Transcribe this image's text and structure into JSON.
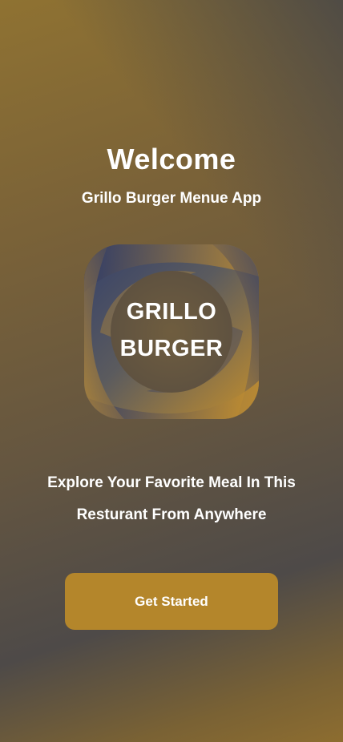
{
  "welcome": {
    "title": "Welcome",
    "subtitle": "Grillo Burger Menue App"
  },
  "logo": {
    "line1": "GRILLO",
    "line2": "BURGER",
    "colors": {
      "gold": "#c48f2c",
      "navy": "#2e3a66",
      "center": "#6b5a3e"
    }
  },
  "tagline": {
    "line1": "Explore Your Favorite Meal In This",
    "line2": "Resturant From Anywhere"
  },
  "cta": {
    "label": "Get Started",
    "color": "#b4862b"
  }
}
